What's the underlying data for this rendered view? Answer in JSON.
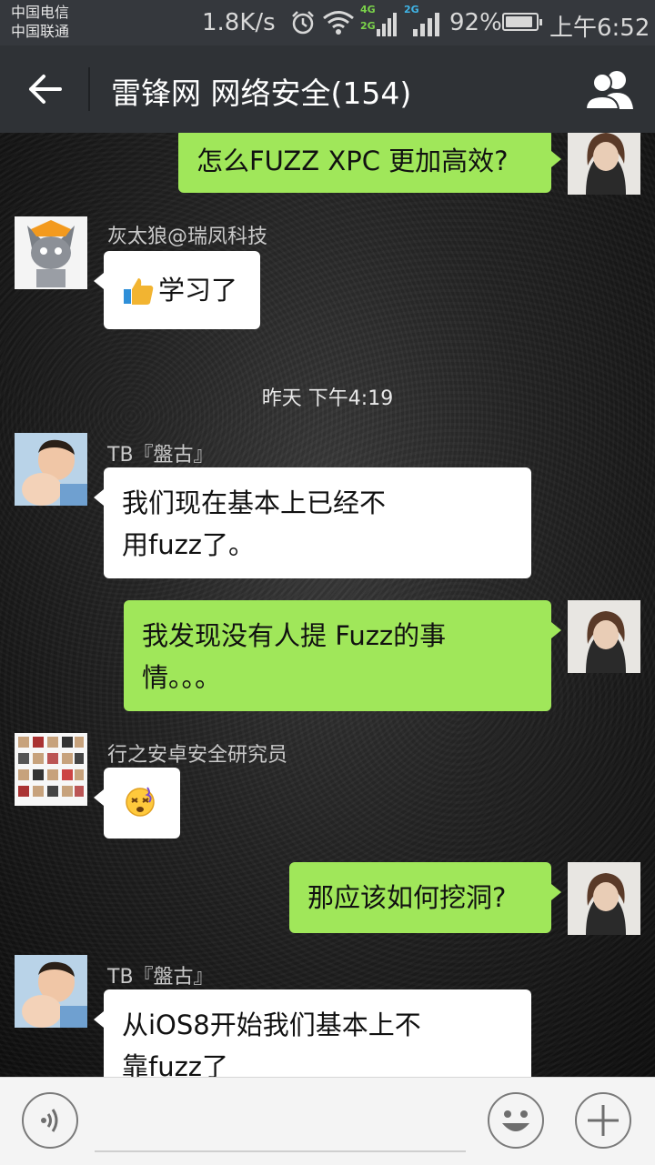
{
  "status_bar": {
    "carrier_1": "中国电信",
    "carrier_2": "中国联通",
    "net_speed": "1.8K/s",
    "network_1": "4G",
    "network_2": "2G",
    "network_3": "2G",
    "battery_percent": "92%",
    "battery_level": 0.92,
    "time": "上午6:52",
    "icons": [
      "alarm-icon",
      "wifi-icon",
      "signal-icon",
      "battery-icon"
    ]
  },
  "header": {
    "title": "雷锋网 网络安全(154)",
    "back_icon": "arrow-left-icon",
    "members_icon": "group-members-icon"
  },
  "messages": [
    {
      "direction": "out",
      "text": "怎么FUZZ XPC 更加高效?"
    },
    {
      "direction": "in",
      "sender": "灰太狼@瑞凤科技",
      "emoji": "thumbs-up-icon",
      "text": "学习了"
    },
    {
      "type": "timestamp",
      "text": "昨天 下午4:19"
    },
    {
      "direction": "in",
      "sender": "TB『盤古』",
      "line1": "我们现在基本上已经不",
      "line2": "用fuzz了。"
    },
    {
      "direction": "out",
      "line1": "我发现没有人提 Fuzz的事",
      "line2": "情。。。"
    },
    {
      "direction": "in",
      "sender": "行之安卓安全研究员",
      "emoji": "dizzy-face-icon"
    },
    {
      "direction": "out",
      "text": "那应该如何挖洞?"
    },
    {
      "direction": "in",
      "sender": "TB『盤古』",
      "line1": "从iOS8开始我们基本上不",
      "line2": "靠fuzz了"
    }
  ],
  "input_bar": {
    "voice_icon": "voice-icon",
    "emoji_icon": "smiley-icon",
    "plus_icon": "plus-icon"
  }
}
